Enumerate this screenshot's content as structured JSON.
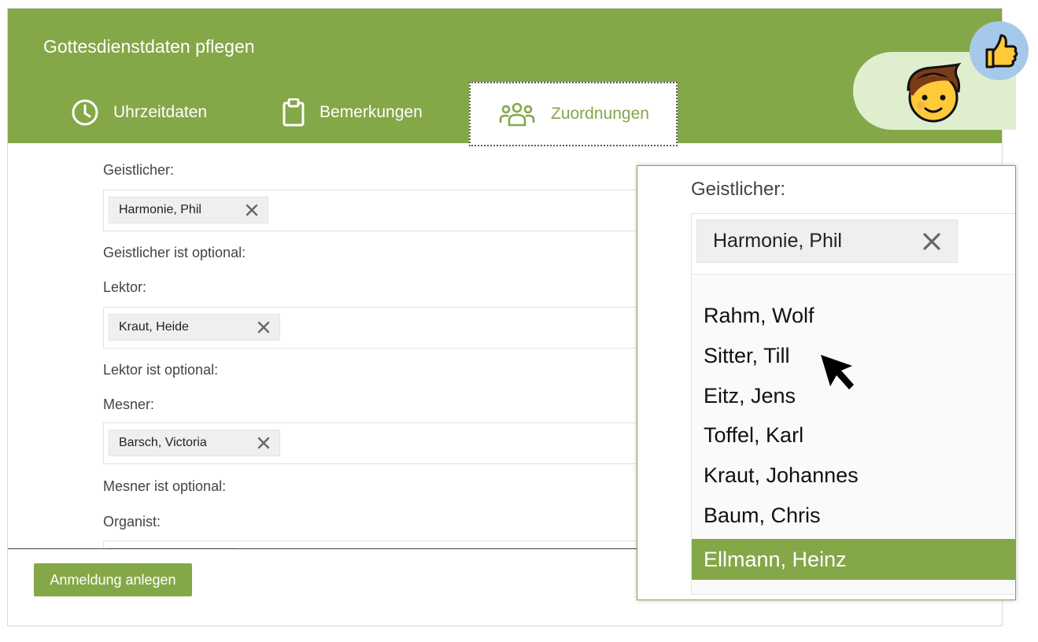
{
  "dialog": {
    "title": "Gottesdienstdaten pflegen",
    "tabs": [
      {
        "label": "Uhrzeitdaten",
        "icon": "clock-icon"
      },
      {
        "label": "Bemerkungen",
        "icon": "clipboard-icon"
      },
      {
        "label": "Zuordnungen",
        "icon": "group-icon",
        "active": true
      }
    ]
  },
  "form": {
    "geistlicher": {
      "label": "Geistlicher:",
      "value": "Harmonie, Phil",
      "optional": "Geistlicher ist optional:"
    },
    "lektor": {
      "label": "Lektor:",
      "value": "Kraut, Heide",
      "optional": "Lektor ist optional:"
    },
    "mesner": {
      "label": "Mesner:",
      "value": "Barsch, Victoria",
      "optional": "Mesner ist optional:"
    },
    "organist": {
      "label": "Organist:"
    }
  },
  "footer": {
    "button_label": "Anmeldung anlegen"
  },
  "zoom": {
    "label": "Geistlicher:",
    "selected_chip": "Harmonie, Phil",
    "options": [
      "Rahm, Wolf",
      "Sitter, Till",
      "Eitz, Jens",
      "Toffel, Karl",
      "Kraut, Johannes",
      "Baum, Chris"
    ],
    "highlighted": "Ellmann, Heinz"
  },
  "colors": {
    "accent": "#84a748",
    "bubble": "#e0eed0",
    "thumb_bg": "#a6c8ea"
  },
  "icons": [
    "clock-icon",
    "clipboard-icon",
    "group-icon",
    "close-icon",
    "avatar-icon",
    "thumbs-up-icon",
    "cursor-icon"
  ]
}
